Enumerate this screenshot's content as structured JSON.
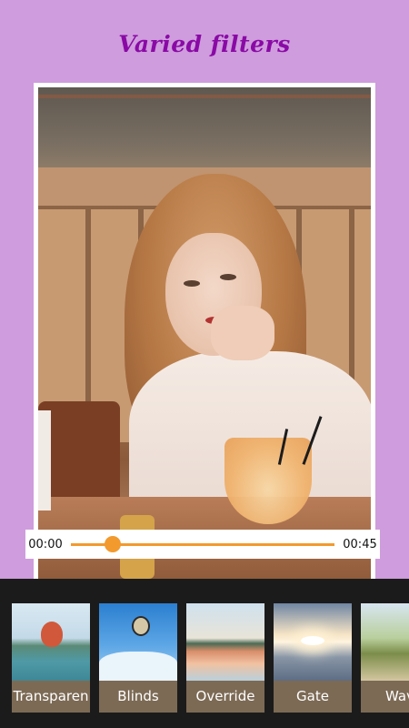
{
  "header": {
    "title": "Varied filters"
  },
  "player": {
    "current_time": "00:00",
    "total_time": "00:45",
    "progress_fraction": 0.16
  },
  "filters": [
    {
      "label": "Transparen"
    },
    {
      "label": "Blinds"
    },
    {
      "label": "Override"
    },
    {
      "label": "Gate"
    },
    {
      "label": "Wav"
    }
  ],
  "colors": {
    "background": "#cf9cdd",
    "title": "#8a0aa6",
    "accent": "#f29a2e",
    "filter_bar": "#1c1b1b",
    "filter_label_bg": "#7c6a55"
  }
}
